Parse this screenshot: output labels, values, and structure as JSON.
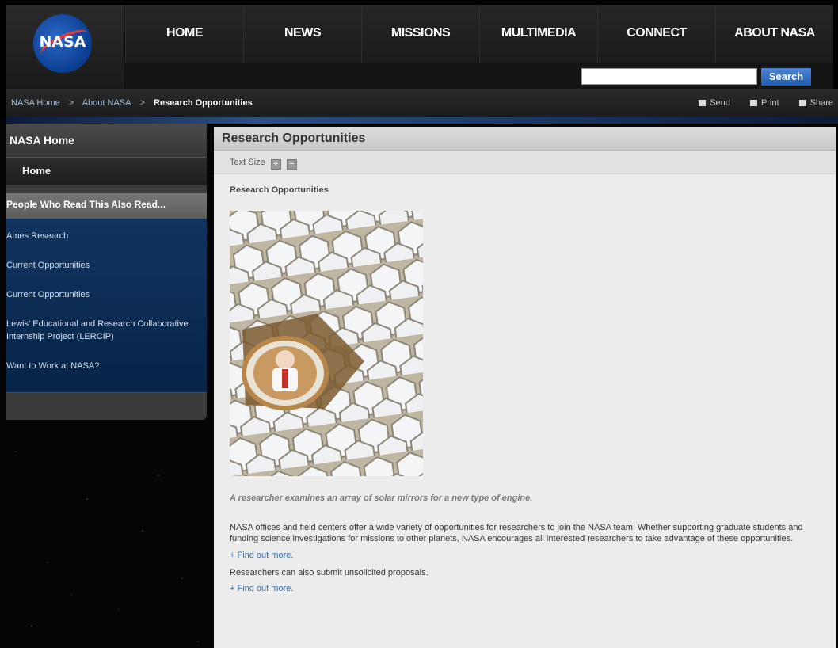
{
  "logo": {
    "text": "NASA"
  },
  "nav": {
    "items": [
      "HOME",
      "NEWS",
      "MISSIONS",
      "MULTIMEDIA",
      "CONNECT",
      "ABOUT NASA"
    ]
  },
  "search": {
    "button_label": "Search",
    "value": ""
  },
  "breadcrumb": {
    "items": [
      "NASA Home",
      "About NASA",
      "Research Opportunities"
    ],
    "separator": ">"
  },
  "tools": {
    "send": "Send",
    "print": "Print",
    "share": "Share"
  },
  "sidebar": {
    "title": "NASA Home",
    "home": "Home",
    "also_read": "People Who Read This Also Read...",
    "links": [
      "Ames Research",
      "Current Opportunities",
      "Current Opportunities",
      "Lewis' Educational and Research Collaborative Internship Project (LERCIP)",
      "Want to Work at NASA?"
    ]
  },
  "main": {
    "title": "Research Opportunities",
    "text_size_label": "Text Size",
    "text_size_plus": "+",
    "text_size_minus": "−",
    "heading": "Research Opportunities",
    "caption": "A researcher examines an array of solar mirrors for a new type of engine.",
    "paragraph": "NASA offices and field centers offer a wide variety of opportunities for researchers to join the NASA team. Whether supporting graduate students and funding science investigations for missions to other planets, NASA encourages all interested researchers to take advantage of these opportunities.",
    "find_more_1": "+ Find out more.",
    "paragraph2": "Researchers can also submit unsolicited proposals.",
    "find_more_2": "+ Find out more."
  },
  "colors": {
    "accent_blue": "#1c5bb6",
    "nasa_blue": "#0b3d91",
    "nasa_red": "#e03a3e",
    "sidebar_links_bg": "#072448"
  }
}
